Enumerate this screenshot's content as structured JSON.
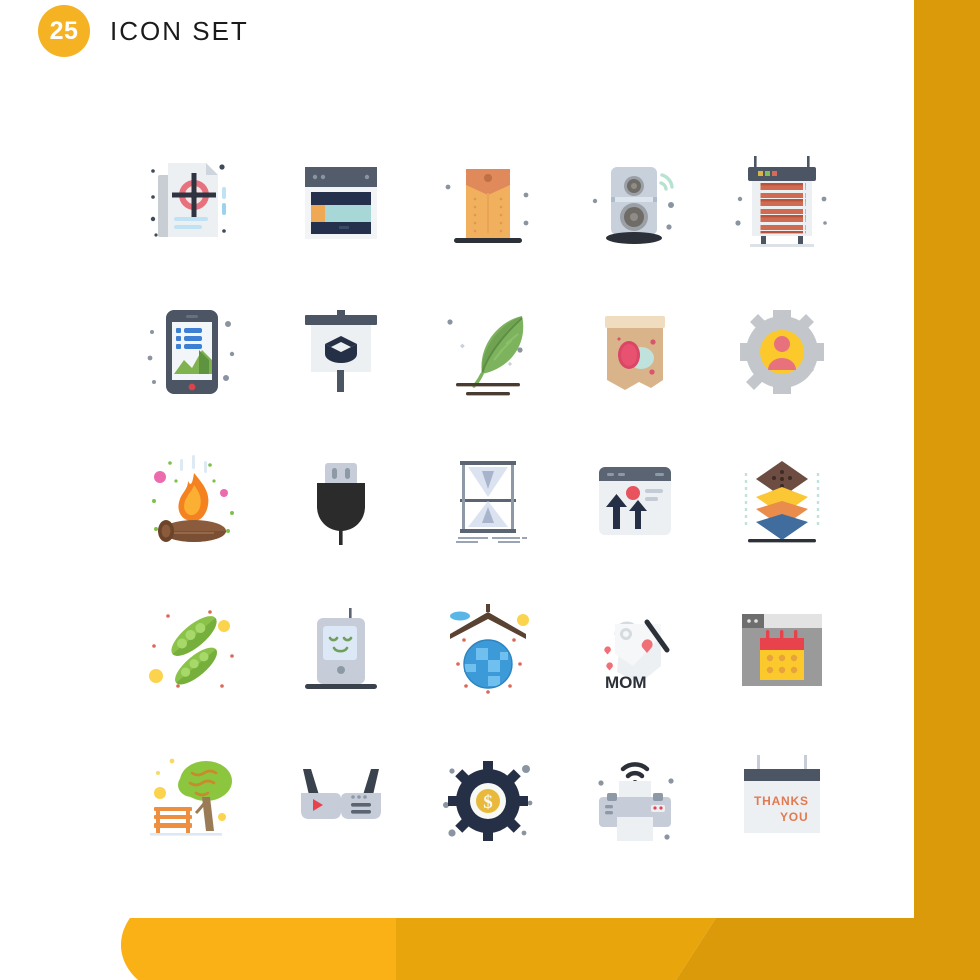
{
  "page": {
    "background": "#ffffff",
    "accent_yellow": "#F5B223",
    "accent_yellow_mid": "#E9A50C",
    "accent_yellow_dark": "#DB9A09"
  },
  "header": {
    "badge_count": "25",
    "title": "Icon Set"
  },
  "grid": {
    "columns": 5,
    "rows": 5,
    "total_icons": 25,
    "icons": [
      {
        "name": "target-document-icon",
        "label": "Target Document"
      },
      {
        "name": "web-layout-icon",
        "label": "Web Layout"
      },
      {
        "name": "envelope-document-icon",
        "label": "Envelope Document"
      },
      {
        "name": "wireless-speaker-icon",
        "label": "Wireless Speaker"
      },
      {
        "name": "room-heater-icon",
        "label": "Room Heater"
      },
      {
        "name": "mobile-analytics-icon",
        "label": "Mobile Analytics"
      },
      {
        "name": "education-board-icon",
        "label": "Education Board"
      },
      {
        "name": "growing-plant-icon",
        "label": "Growing Plant"
      },
      {
        "name": "easter-egg-banner-icon",
        "label": "Easter Egg Banner"
      },
      {
        "name": "user-settings-icon",
        "label": "User Settings"
      },
      {
        "name": "bonfire-icon",
        "label": "Bonfire"
      },
      {
        "name": "electric-plug-icon",
        "label": "Electric Plug"
      },
      {
        "name": "hourglass-icon",
        "label": "Hourglass"
      },
      {
        "name": "growth-browser-icon",
        "label": "Growth Browser"
      },
      {
        "name": "layers-stack-icon",
        "label": "Layers Stack"
      },
      {
        "name": "pea-pods-icon",
        "label": "Pea Pods"
      },
      {
        "name": "baby-monitor-icon",
        "label": "Baby Monitor"
      },
      {
        "name": "global-home-icon",
        "label": "Global Home"
      },
      {
        "name": "mom-gift-tag-icon",
        "label": "Mom Gift Tag"
      },
      {
        "name": "calendar-browser-icon",
        "label": "Calendar Browser"
      },
      {
        "name": "park-bench-tree-icon",
        "label": "Park Bench Tree"
      },
      {
        "name": "smart-glasses-icon",
        "label": "Smart Glasses"
      },
      {
        "name": "money-gear-icon",
        "label": "Money Gear"
      },
      {
        "name": "wireless-printer-icon",
        "label": "Wireless Printer"
      },
      {
        "name": "thanks-banner-icon",
        "label": "Thanks Banner"
      }
    ]
  },
  "icon_text": {
    "mom_tag": "MOM",
    "thanks_line1": "THANKS",
    "thanks_line2": "YOU",
    "money_gear_symbol": "$"
  }
}
